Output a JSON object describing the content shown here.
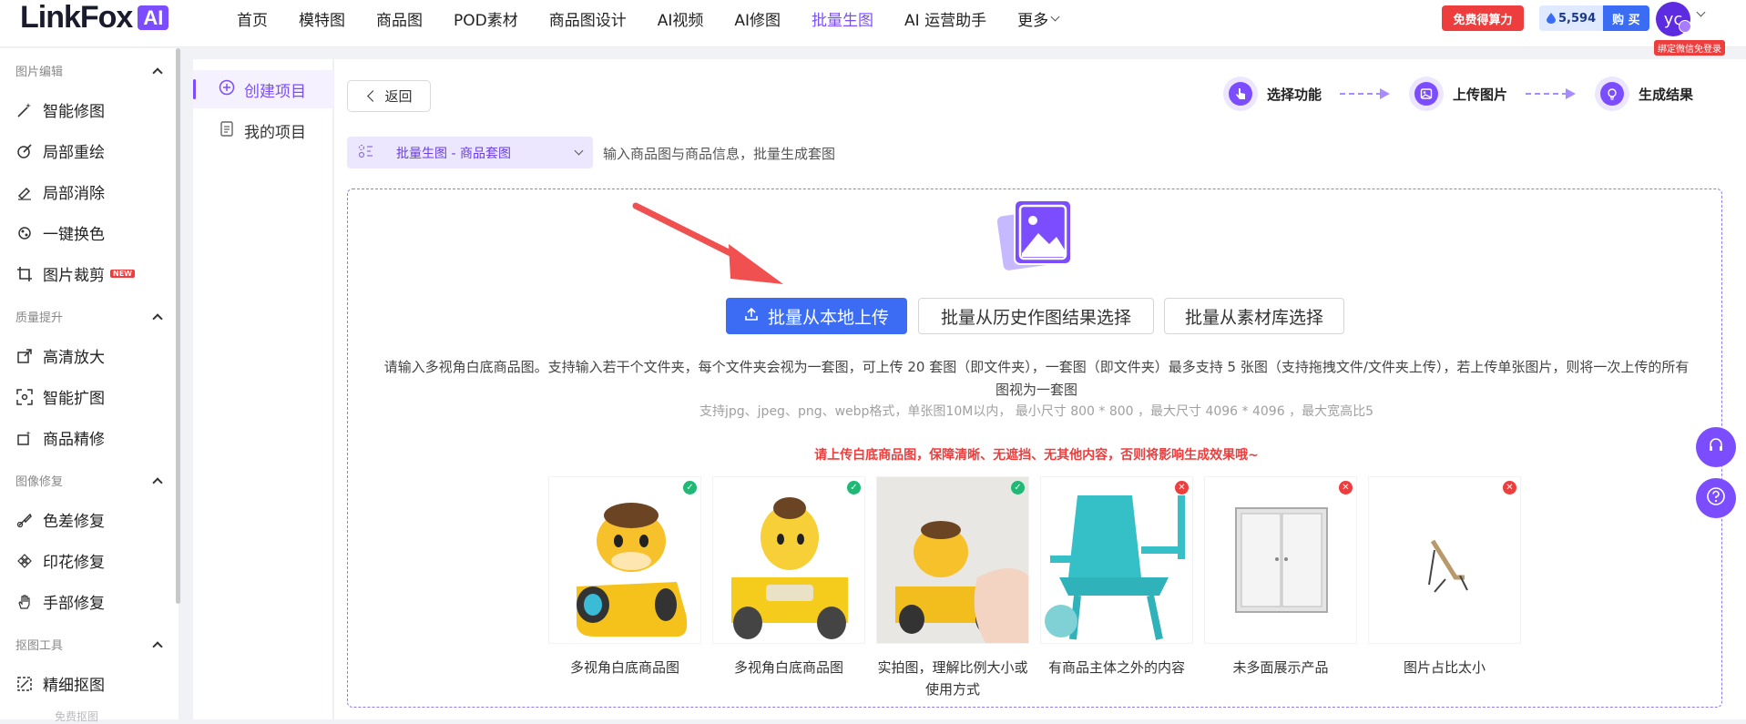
{
  "app": {
    "logo_text": "LinkFox",
    "logo_badge": "AI"
  },
  "nav": {
    "items": [
      "首页",
      "模特图",
      "商品图",
      "POD素材",
      "商品图设计",
      "AI视频",
      "AI修图",
      "批量生图",
      "AI 运营助手"
    ],
    "more": "更多",
    "active": "批量生图"
  },
  "header": {
    "free_btn": "免费得算力",
    "credits": "5,594",
    "buy": "购 买",
    "avatar": "yc",
    "bind_tag": "绑定微信免登录"
  },
  "sidebar": {
    "sections": [
      {
        "title": "图片编辑",
        "items": [
          {
            "label": "智能修图",
            "icon": "magic-wand-icon"
          },
          {
            "label": "局部重绘",
            "icon": "brush-icon"
          },
          {
            "label": "局部消除",
            "icon": "eraser-icon"
          },
          {
            "label": "一键换色",
            "icon": "palette-icon"
          },
          {
            "label": "图片裁剪",
            "icon": "crop-icon",
            "badge": "NEW"
          }
        ]
      },
      {
        "title": "质量提升",
        "items": [
          {
            "label": "高清放大",
            "icon": "upscale-icon"
          },
          {
            "label": "智能扩图",
            "icon": "expand-icon"
          },
          {
            "label": "商品精修",
            "icon": "retouch-icon"
          }
        ]
      },
      {
        "title": "图像修复",
        "items": [
          {
            "label": "色差修复",
            "icon": "color-fix-icon"
          },
          {
            "label": "印花修复",
            "icon": "pattern-icon"
          },
          {
            "label": "手部修复",
            "icon": "hand-icon"
          }
        ]
      },
      {
        "title": "抠图工具",
        "items": [
          {
            "label": "精细抠图",
            "icon": "cutout-icon"
          }
        ]
      }
    ],
    "partial": "免费抠图"
  },
  "subnav": {
    "items": [
      {
        "label": "创建项目",
        "icon": "plus-circle-icon"
      },
      {
        "label": "我的项目",
        "icon": "list-icon"
      }
    ]
  },
  "main": {
    "back": "返回",
    "steps": [
      "选择功能",
      "上传图片",
      "生成结果"
    ],
    "mode_select": "批量生图 - 商品套图",
    "mode_desc": "输入商品图与商品信息，批量生成套图",
    "upload_local": "批量从本地上传",
    "from_history": "批量从历史作图结果选择",
    "from_library": "批量从素材库选择",
    "info_line1": "请输入多视角白底商品图。支持输入若干个文件夹，每个文件夹会视为一套图，可上传 20 套图（即文件夹），一套图（即文件夹）最多支持 5 张图（支持拖拽文件/文件夹上传），若上传单张图片，则将一次上传的所有图视为一套图",
    "info_line2": "支持jpg、jpeg、png、webp格式，单张图10M以内， 最小尺寸 800 * 800 ，最大尺寸 4096 * 4096 ，最大宽高比5",
    "warning": "请上传白底商品图，保障清晰、无遮挡、无其他内容，否则将影响生成效果哦~",
    "samples": [
      {
        "label": "多视角白底商品图",
        "ok": true
      },
      {
        "label": "多视角白底商品图",
        "ok": true
      },
      {
        "label": "实拍图，理解比例大小或使用方式",
        "ok": true
      },
      {
        "label": "有商品主体之外的内容",
        "ok": false
      },
      {
        "label": "未多面展示产品",
        "ok": false
      },
      {
        "label": "图片占比太小",
        "ok": false
      }
    ]
  },
  "colors": {
    "accent": "#7b4dff",
    "primary": "#3c6cf4",
    "danger": "#ee3d3d",
    "ok": "#1fb874"
  }
}
